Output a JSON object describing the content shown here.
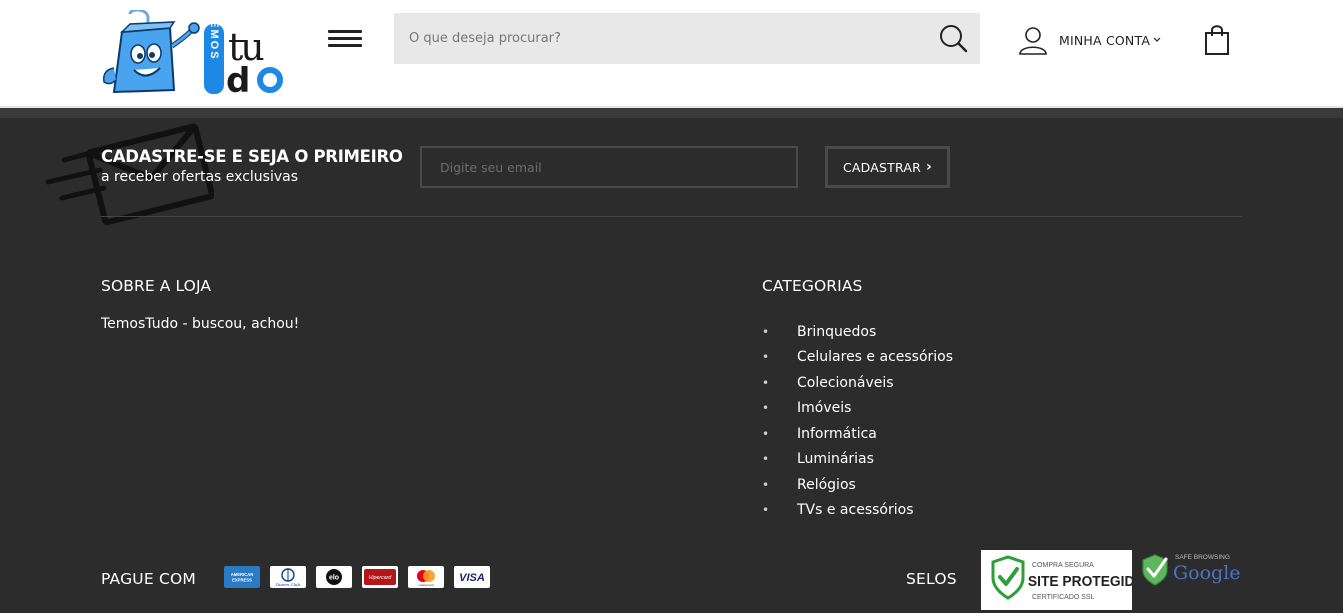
{
  "header": {
    "logo_text_vertical": "TEMOS",
    "logo_text_main": "tudo",
    "search_placeholder": "O que deseja procurar?",
    "account_label": "MINHA CONTA"
  },
  "newsletter": {
    "title": "CADASTRE-SE E SEJA O PRIMEIRO",
    "subtitle": "a receber ofertas exclusivas",
    "email_placeholder": "Digite seu email",
    "button_label": "CADASTRAR"
  },
  "about": {
    "title": "SOBRE A LOJA",
    "text": "TemosTudo - buscou, achou!"
  },
  "categories": {
    "title": "CATEGORIAS",
    "items": [
      "Brinquedos",
      "Celulares e acessórios",
      "Colecionáveis",
      "Imóveis",
      "Informática",
      "Luminárias",
      "Relógios",
      "TVs e acessórios"
    ]
  },
  "payment": {
    "title": "PAGUE COM",
    "cards": [
      {
        "name": "amex",
        "label": "AMERICAN EXPRESS"
      },
      {
        "name": "diners",
        "label": "Diners Club"
      },
      {
        "name": "elo",
        "label": "elo"
      },
      {
        "name": "hipercard",
        "label": "Hipercard"
      },
      {
        "name": "mastercard",
        "label": "mastercard"
      },
      {
        "name": "visa",
        "label": "VISA"
      }
    ]
  },
  "seals": {
    "title": "SELOS",
    "ssl_line1": "COMPRA SEGURA",
    "ssl_line2": "SITE PROTEGIDO",
    "ssl_line3": "CERTIFICADO SSL",
    "google_line1": "SAFE BROWSING",
    "google_line2": "Google"
  },
  "colors": {
    "footer_bg": "#2c2c2c",
    "logo_blue": "#1e88e5",
    "search_bg": "#e8e8e8"
  }
}
